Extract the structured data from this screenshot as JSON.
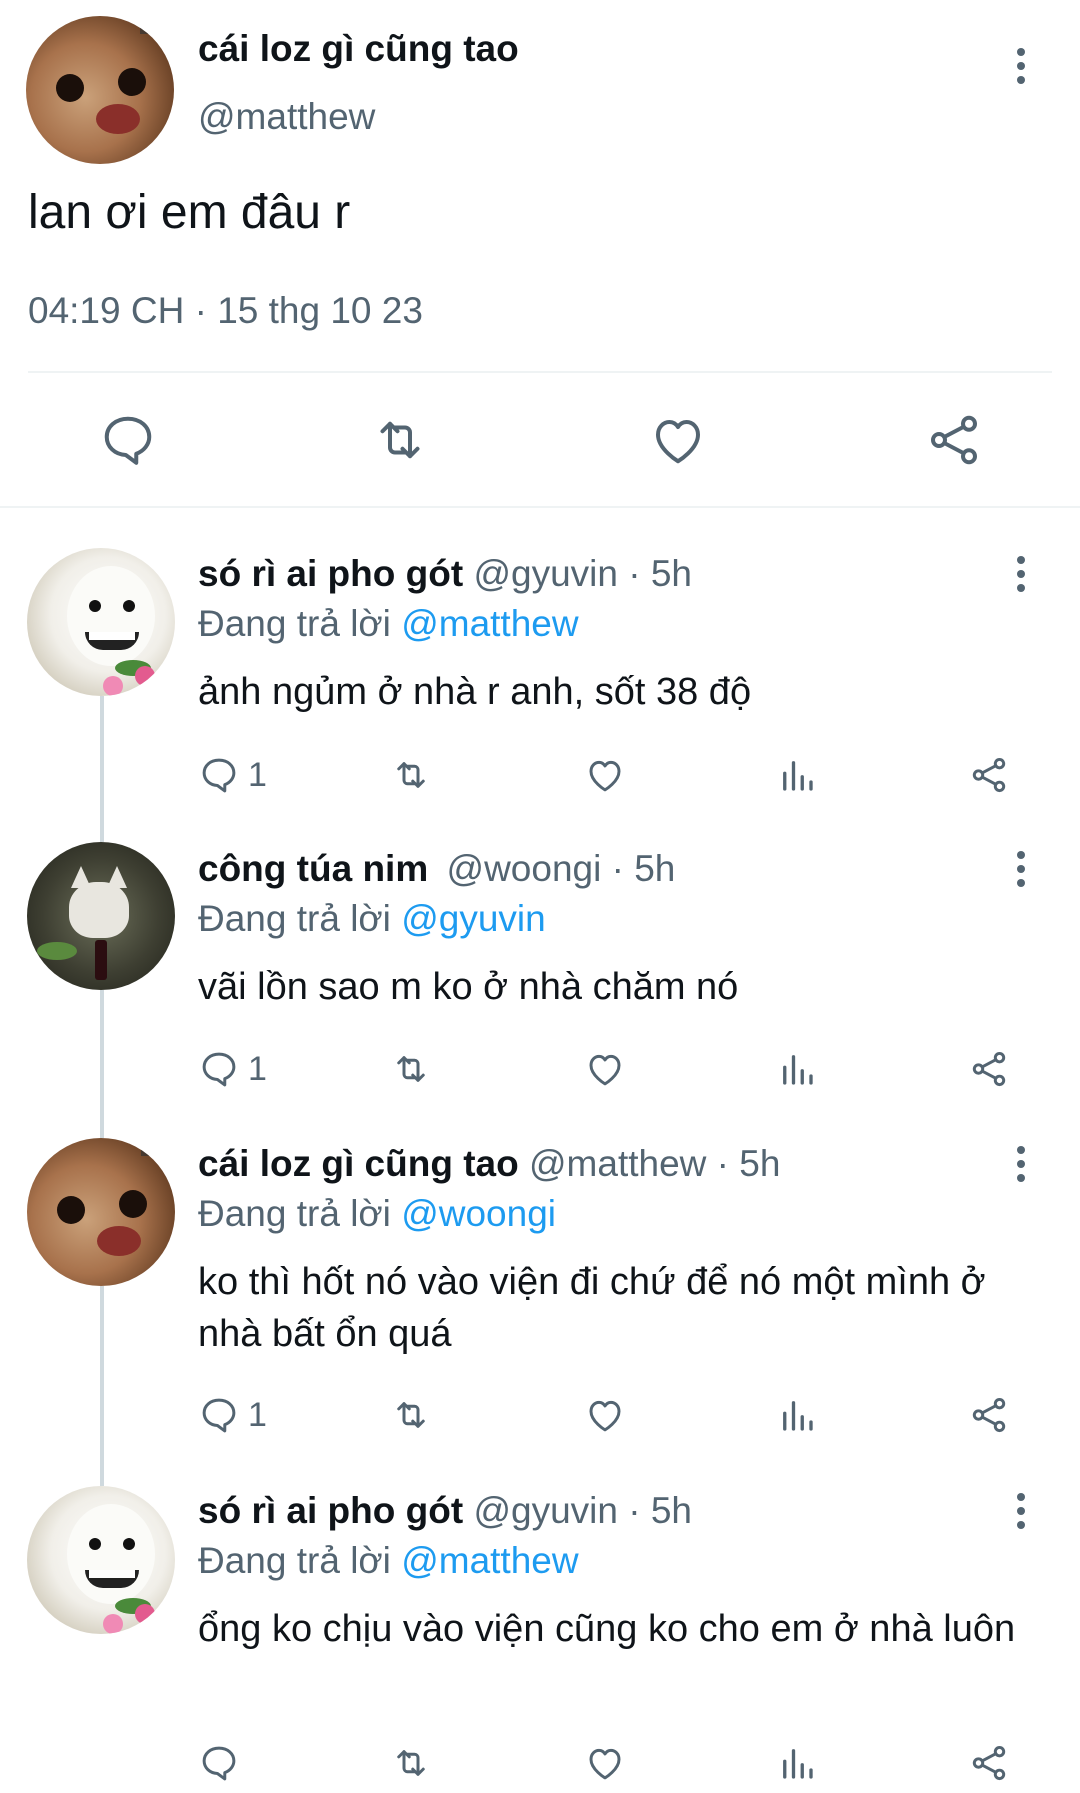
{
  "main_tweet": {
    "display_name": "cái loz gì cũng tao",
    "handle": "@matthew",
    "text": "lan ơi em đâu r",
    "timestamp": "04:19 CH · 15 thg 10 23",
    "avatar_icon": "chihuahua-avatar",
    "actions": [
      "reply-icon",
      "retweet-icon",
      "like-icon",
      "share-icon"
    ]
  },
  "replies": [
    {
      "display_name": "só rì ai pho gót",
      "handle_time": "@gyuvin · 5h",
      "replying_prefix": "Đang trả lời ",
      "replying_to": "@matthew",
      "text": "ảnh ngủm ở nhà r anh, sốt 38 độ",
      "reply_count": "1",
      "avatar_icon": "white-dog-avatar"
    },
    {
      "display_name": "công túa nim",
      "handle_time": "@woongi · 5h",
      "replying_prefix": "Đang trả lời ",
      "replying_to": "@gyuvin",
      "text": "vãi lồn sao m ko ở nhà chăm nó",
      "reply_count": "1",
      "avatar_icon": "dog-with-wine-avatar"
    },
    {
      "display_name": "cái loz gì cũng tao",
      "handle_time": "@matthew · 5h",
      "replying_prefix": "Đang trả lời ",
      "replying_to": "@woongi",
      "text": "ko thì hốt nó vào viện đi chứ để nó một mình ở nhà bất ổn quá",
      "reply_count": "1",
      "avatar_icon": "chihuahua-avatar"
    },
    {
      "display_name": "só rì ai pho gót",
      "handle_time": "@gyuvin · 5h",
      "replying_prefix": "Đang trả lời ",
      "replying_to": "@matthew",
      "text": "ổng ko chịu vào viện cũng ko cho em ở nhà luôn",
      "reply_count": "",
      "avatar_icon": "white-dog-avatar"
    }
  ],
  "colors": {
    "link": "#1d9bf0",
    "secondary_text": "#536471",
    "primary_text": "#0f1419",
    "divider": "#eff3f4"
  }
}
